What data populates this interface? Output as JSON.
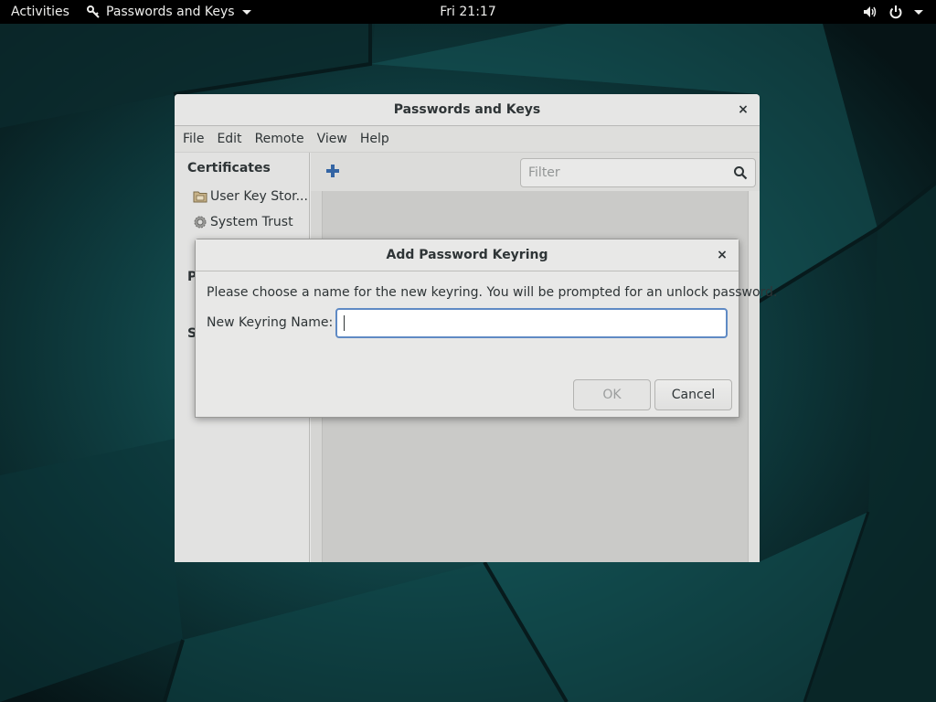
{
  "topbar": {
    "activities": "Activities",
    "app_name": "Passwords and Keys",
    "clock": "Fri 21:17"
  },
  "main_window": {
    "title": "Passwords and Keys",
    "close_glyph": "×",
    "menu": [
      "File",
      "Edit",
      "Remote",
      "View",
      "Help"
    ],
    "sidebar": {
      "certificates_heading": "Certificates",
      "items": [
        {
          "label": "User Key Stor...",
          "icon": "folder-icon"
        },
        {
          "label": "System Trust",
          "icon": "gear-icon"
        }
      ],
      "partial_headings": [
        "P",
        "S"
      ]
    },
    "toolbar": {
      "add_icon": "plus-icon",
      "filter_placeholder": "Filter",
      "search_icon": "search-icon"
    }
  },
  "dialog": {
    "title": "Add Password Keyring",
    "close_glyph": "×",
    "message": "Please choose a name for the new keyring. You will be prompted for an unlock password.",
    "name_label": "New Keyring Name:",
    "name_value": "",
    "ok_label": "OK",
    "cancel_label": "Cancel",
    "ok_disabled": true
  },
  "colors": {
    "focus_ring": "#5f8ac4",
    "add_icon": "#3465a4",
    "topbar_bg": "#000000"
  }
}
